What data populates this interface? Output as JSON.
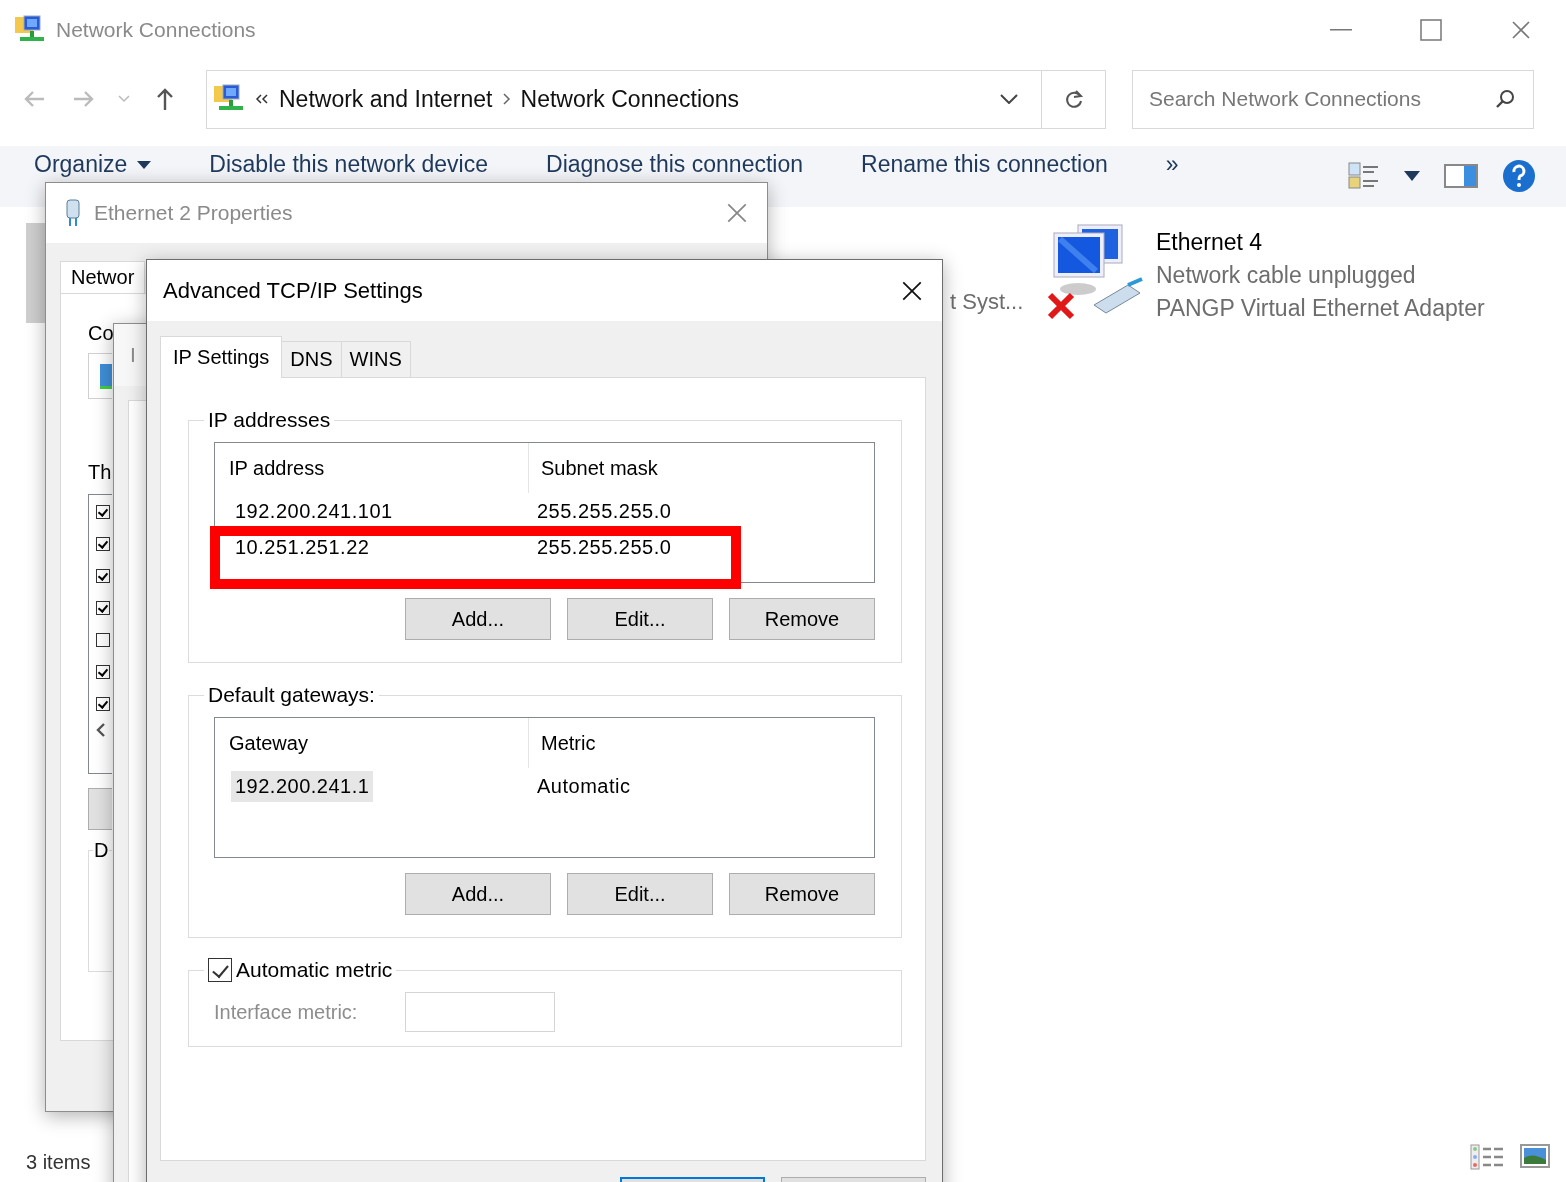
{
  "explorer": {
    "title": "Network Connections",
    "breadcrumb": [
      "Network and Internet",
      "Network Connections"
    ],
    "search": {
      "placeholder": "Search Network Connections"
    },
    "commands": [
      {
        "label": "Organize",
        "kind": "menu"
      },
      {
        "label": "Disable this network device",
        "kind": "action"
      },
      {
        "label": "Diagnose this connection",
        "kind": "action"
      },
      {
        "label": "Rename this connection",
        "kind": "action"
      },
      {
        "label": "»",
        "kind": "more"
      }
    ],
    "hidden_item_text": "t Syst...",
    "items": [
      {
        "name": "Ethernet 4",
        "status": "Network cable unplugged",
        "device": "PANGP Virtual Ethernet Adapter",
        "connected": false
      }
    ],
    "status_bar": "3 items"
  },
  "properties_window": {
    "title": "Ethernet 2 Properties",
    "tab": "Networ",
    "label_1": "Co",
    "label_2": "Th",
    "group_label": "D",
    "components": [
      {
        "checked": true
      },
      {
        "checked": true
      },
      {
        "checked": true
      },
      {
        "checked": true
      },
      {
        "checked": false
      },
      {
        "checked": true
      },
      {
        "checked": true
      }
    ]
  },
  "ipv4_window": {
    "title": "I"
  },
  "advanced_dialog": {
    "title": "Advanced TCP/IP Settings",
    "tabs": [
      {
        "label": "IP Settings",
        "selected": true
      },
      {
        "label": "DNS",
        "selected": false
      },
      {
        "label": "WINS",
        "selected": false
      }
    ],
    "ip_addresses": {
      "label": "IP addresses",
      "columns": [
        "IP address",
        "Subnet mask"
      ],
      "rows": [
        {
          "cells": [
            "192.200.241.101",
            "255.255.255.0"
          ],
          "selected": false,
          "highlighted": false
        },
        {
          "cells": [
            "10.251.251.22",
            "255.255.255.0"
          ],
          "selected": false,
          "highlighted": true
        }
      ],
      "buttons": [
        "Add...",
        "Edit...",
        "Remove"
      ]
    },
    "default_gateways": {
      "label": "Default gateways:",
      "columns": [
        "Gateway",
        "Metric"
      ],
      "rows": [
        {
          "cells": [
            "192.200.241.1",
            "Automatic"
          ],
          "selected": true,
          "highlighted": false
        }
      ],
      "buttons": [
        "Add...",
        "Edit...",
        "Remove"
      ]
    },
    "automatic_metric": {
      "label": "Automatic metric",
      "checked": true
    },
    "interface_metric": {
      "label": "Interface metric:",
      "disabled": true
    },
    "footer_buttons": [
      {
        "default": true
      },
      {
        "default": false
      }
    ]
  }
}
